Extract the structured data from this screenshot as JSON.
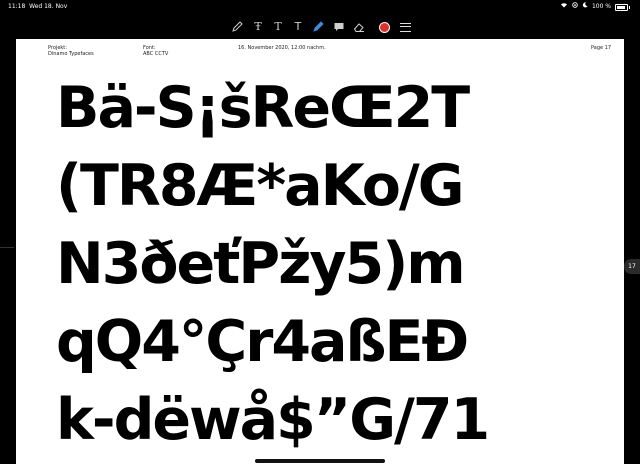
{
  "status_bar": {
    "time": "11:18",
    "date": "Wed 18. Nov",
    "battery": "100 %"
  },
  "toolbar": {
    "tools": [
      "pencil-icon",
      "text-style-icon",
      "text-icon",
      "text-alt-icon",
      "highlighter-icon",
      "comment-icon",
      "eraser-icon"
    ],
    "accent_color": "#e0302a"
  },
  "document": {
    "header": {
      "project_label": "Projekt:",
      "project_value": "Dinamo Typefaces",
      "font_label": "Font:",
      "font_value": "ABC CCTV",
      "date": "16. November 2020, 12:00 nachm.",
      "page": "Page 17"
    },
    "specimen_lines": [
      "Bä-S¡šReŒ2T",
      "(TR8Æ*aKo/G",
      "N3ðeťPžy5)m",
      "qQ4°Çr4aßEĐ",
      "k-dëwå$”G/71"
    ]
  },
  "page_indicator": "17"
}
